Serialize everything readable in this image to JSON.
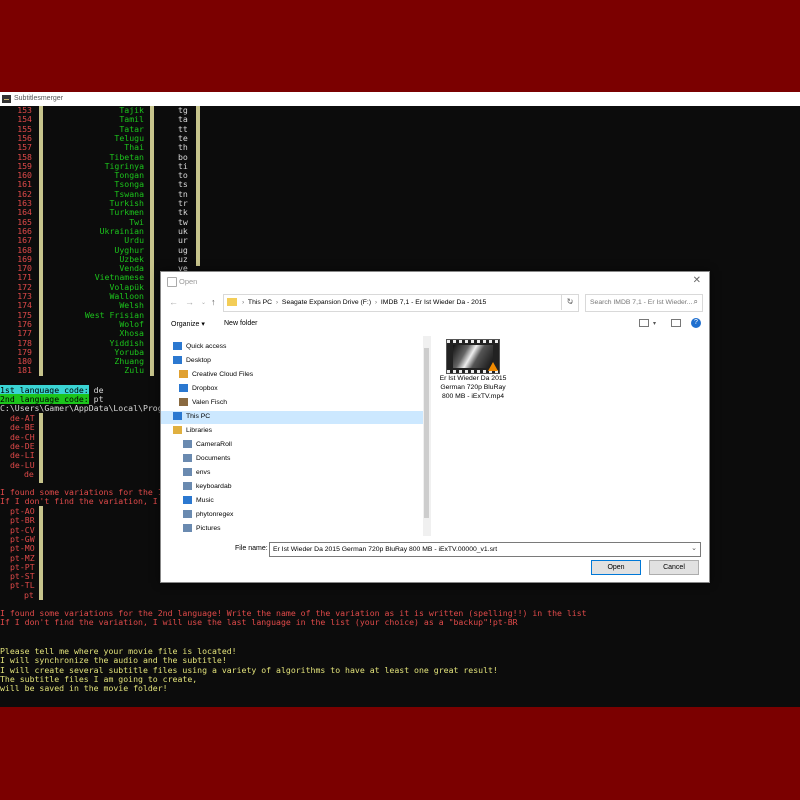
{
  "console": {
    "title": "Subtitlesmerger",
    "languages": [
      {
        "n": "153",
        "name": "Tajik",
        "code": "tg"
      },
      {
        "n": "154",
        "name": "Tamil",
        "code": "ta"
      },
      {
        "n": "155",
        "name": "Tatar",
        "code": "tt"
      },
      {
        "n": "156",
        "name": "Telugu",
        "code": "te"
      },
      {
        "n": "157",
        "name": "Thai",
        "code": "th"
      },
      {
        "n": "158",
        "name": "Tibetan",
        "code": "bo"
      },
      {
        "n": "159",
        "name": "Tigrinya",
        "code": "ti"
      },
      {
        "n": "160",
        "name": "Tongan",
        "code": "to"
      },
      {
        "n": "161",
        "name": "Tsonga",
        "code": "ts"
      },
      {
        "n": "162",
        "name": "Tswana",
        "code": "tn"
      },
      {
        "n": "163",
        "name": "Turkish",
        "code": "tr"
      },
      {
        "n": "164",
        "name": "Turkmen",
        "code": "tk"
      },
      {
        "n": "165",
        "name": "Twi",
        "code": "tw"
      },
      {
        "n": "166",
        "name": "Ukrainian",
        "code": "uk"
      },
      {
        "n": "167",
        "name": "Urdu",
        "code": "ur"
      },
      {
        "n": "168",
        "name": "Uyghur",
        "code": "ug"
      },
      {
        "n": "169",
        "name": "Uzbek",
        "code": "uz"
      },
      {
        "n": "170",
        "name": "Venda",
        "code": "ve"
      },
      {
        "n": "171",
        "name": "Vietnamese",
        "code": ""
      },
      {
        "n": "172",
        "name": "Volapük",
        "code": ""
      },
      {
        "n": "173",
        "name": "Walloon",
        "code": ""
      },
      {
        "n": "174",
        "name": "Welsh",
        "code": ""
      },
      {
        "n": "175",
        "name": "West Frisian",
        "code": ""
      },
      {
        "n": "176",
        "name": "Wolof",
        "code": ""
      },
      {
        "n": "177",
        "name": "Xhosa",
        "code": ""
      },
      {
        "n": "178",
        "name": "Yiddish",
        "code": ""
      },
      {
        "n": "179",
        "name": "Yoruba",
        "code": ""
      },
      {
        "n": "180",
        "name": "Zhuang",
        "code": ""
      },
      {
        "n": "181",
        "name": "Zulu",
        "code": ""
      }
    ],
    "lang1_prompt": "1st language code:",
    "lang1_value": " de",
    "lang2_prompt": "2nd language code:",
    "lang2_value": " pt",
    "path_line": "C:\\Users\\Gamer\\AppData\\Local\\Progr",
    "variants1": [
      "de-AT",
      "de-BE",
      "de-CH",
      "de-DE",
      "de-LI",
      "de-LU",
      "de"
    ],
    "found1": "I found some variations for the 1s",
    "dontfind1": "If I don't find the variation, I w",
    "variants2": [
      "pt-AO",
      "pt-BR",
      "pt-CV",
      "pt-GW",
      "pt-MO",
      "pt-MZ",
      "pt-PT",
      "pt-ST",
      "pt-TL",
      "pt"
    ],
    "found2": "I found some variations for the 2nd language! Write the name of the variation as it is written (spelling!!) in the list",
    "dontfind2": "If I don't find the variation, I will use the last language in the list (your choice) as a \"backup\"!pt-BR",
    "msg": [
      "Please tell me where your movie file is located!",
      "I will synchronize the audio and the subtitle!",
      "I will create several subtitle files using a variety of algorithms to have at least one great result!",
      "The subtitle files I am going to create,",
      "will be saved in the movie folder!"
    ]
  },
  "dialog": {
    "title": "Open",
    "breadcrumbs": [
      "This PC",
      "Seagate Expansion Drive (F:)",
      "IMDB 7,1 - Er Ist Wieder Da - 2015"
    ],
    "search_placeholder": "Search IMDB 7,1 - Er Ist Wieder...",
    "organize": "Organize ▾",
    "new_folder": "New folder",
    "nav_items": [
      {
        "label": "Quick access",
        "icon": "star-icon",
        "color": "#2b78d0"
      },
      {
        "label": "Desktop",
        "icon": "desktop-icon",
        "color": "#2b78d0"
      },
      {
        "label": "Creative Cloud Files",
        "icon": "creative-cloud-icon",
        "color": "#e0a030"
      },
      {
        "label": "Dropbox",
        "icon": "dropbox-icon",
        "color": "#2b78d0"
      },
      {
        "label": "Valen Fisch",
        "icon": "user-icon",
        "color": "#8a6a40"
      },
      {
        "label": "This PC",
        "icon": "computer-icon",
        "color": "#2b78d0"
      },
      {
        "label": "Libraries",
        "icon": "libraries-icon",
        "color": "#e0b040"
      },
      {
        "label": "CameraRoll",
        "icon": "library-folder-icon",
        "color": "#6a8ab0"
      },
      {
        "label": "Documents",
        "icon": "documents-icon",
        "color": "#6a8ab0"
      },
      {
        "label": "envs",
        "icon": "library-folder-icon",
        "color": "#6a8ab0"
      },
      {
        "label": "keyboardab",
        "icon": "library-folder-icon",
        "color": "#6a8ab0"
      },
      {
        "label": "Music",
        "icon": "music-icon",
        "color": "#2b78d0"
      },
      {
        "label": "phytonregex",
        "icon": "library-folder-icon",
        "color": "#6a8ab0"
      },
      {
        "label": "Pictures",
        "icon": "pictures-icon",
        "color": "#6a8ab0"
      }
    ],
    "file_name_text": "Er Ist Wieder Da 2015 German 720p BluRay 800 MB - iExTV.mp4",
    "file_name_label": "File name:",
    "file_name_value": "Er Ist Wieder Da 2015 German 720p BluRay 800 MB - iExTV.00000_v1.srt",
    "open_label": "Open",
    "cancel_label": "Cancel"
  }
}
